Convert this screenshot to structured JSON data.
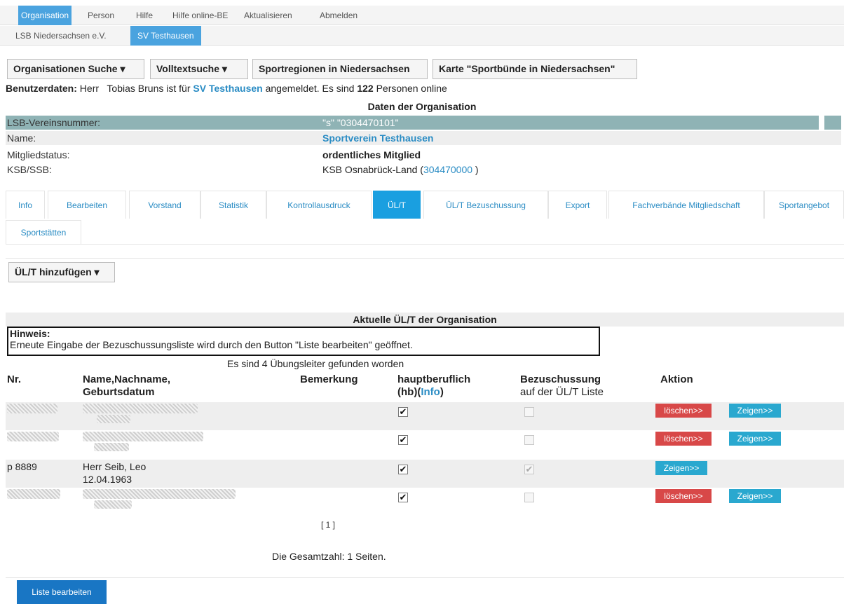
{
  "topnav": [
    "Organisation",
    "Person",
    "Hilfe",
    "Hilfe online-BE",
    "Aktualisieren",
    "Abmelden"
  ],
  "subnav": [
    "LSB Niedersachsen e.V.",
    "SV Testhausen"
  ],
  "toolbar": {
    "org_search": "Organisationen Suche ▾",
    "fulltext": "Volltextsuche ▾",
    "regions": "Sportregionen in Niedersachsen",
    "map": "Karte \"Sportbünde in Niedersachsen\""
  },
  "user": {
    "label": "Benutzerdaten:",
    "text1": " Herr   Tobias Bruns ist für ",
    "org": "SV Testhausen",
    "text2": " angemeldet. Es sind ",
    "count": "122",
    "text3": " Personen online"
  },
  "org": {
    "title": "Daten der Organisation",
    "rows": [
      {
        "label": "LSB-Vereinsnummer:",
        "value": "\"s\" \"0304470101\""
      },
      {
        "label": "Name:",
        "value": "Sportverein Testhausen"
      },
      {
        "label": "Mitgliedstatus:",
        "value": "ordentliches Mitglied"
      },
      {
        "label": "KSB/SSB:",
        "value_prefix": "KSB Osnabrück-Land (",
        "value_link": "304470000",
        "value_suffix": " )"
      }
    ]
  },
  "tabs": [
    "Info",
    "Bearbeiten",
    "Vorstand",
    "Statistik",
    "Kontrollausdruck",
    "ÜL/T",
    "ÜL/T Bezuschussung",
    "Export",
    "Fachverbände Mitgliedschaft",
    "Sportangebot",
    "Sportstätten"
  ],
  "add_button": "ÜL/T hinzufügen ▾",
  "section_title": "Aktuelle ÜL/T der Organisation",
  "hint": {
    "title": "Hinweis:",
    "text": "Erneute Eingabe der Bezuschussungsliste wird durch den Button \"Liste bearbeiten\" geöffnet."
  },
  "found_text": "Es sind 4 Übungsleiter gefunden worden",
  "headers": {
    "nr": "Nr.",
    "name1": "Name,Nachname,",
    "name2": "Geburtsdatum",
    "remark": "Bemerkung",
    "hb1": "hauptberuflich",
    "hb2": "(hb)(",
    "hb_info": "Info",
    "hb3": ")",
    "bez1": "Bezuschussung",
    "bez2": "auf der ÜL/T Liste",
    "action": "Aktion"
  },
  "visible_row": {
    "nr": "p 8889",
    "name": "Herr Seib, Leo",
    "dob": "12.04.1963"
  },
  "buttons": {
    "delete": "löschen>>",
    "show": "Zeigen>>"
  },
  "checks": {
    "checked": "✔"
  },
  "pager": "[ 1 ]",
  "total": "Die Gesamtzahl: 1 Seiten.",
  "list_button": "Liste bearbeiten"
}
